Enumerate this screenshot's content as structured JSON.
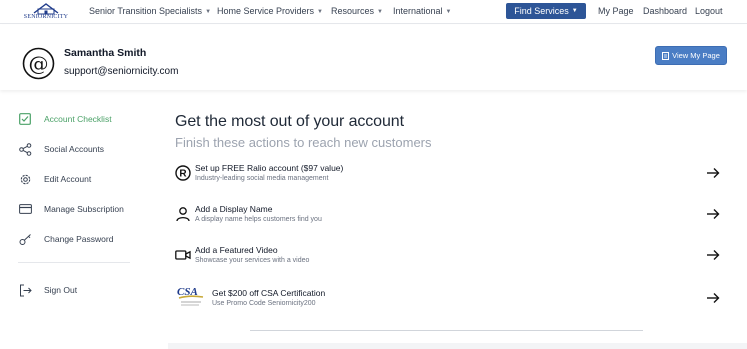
{
  "nav": {
    "logo_text": "SENIORNICITY",
    "items": [
      {
        "label": "Senior Transition Specialists"
      },
      {
        "label": "Home Service Providers"
      },
      {
        "label": "Resources"
      },
      {
        "label": "International"
      }
    ],
    "find_services": "Find Services",
    "my_page": "My Page",
    "dashboard": "Dashboard",
    "logout": "Logout"
  },
  "profile": {
    "avatar_icon": "at-sign-icon",
    "name": "Samantha Smith",
    "email": "support@seniornicity.com",
    "view_button": "View My Page"
  },
  "sidebar": {
    "items": [
      {
        "label": "Account Checklist",
        "icon": "checkbox-icon",
        "active": true
      },
      {
        "label": "Social Accounts",
        "icon": "share-icon"
      },
      {
        "label": "Edit Account",
        "icon": "gear-icon"
      },
      {
        "label": "Manage Subscription",
        "icon": "credit-card-icon"
      },
      {
        "label": "Change Password",
        "icon": "key-icon"
      }
    ],
    "sign_out": "Sign Out"
  },
  "main": {
    "title": "Get the most out of your account",
    "subtitle": "Finish these actions to reach new customers",
    "actions": [
      {
        "title": "Set up FREE Ralio account ($97 value)",
        "desc": "Industry-leading social media management",
        "icon": "ralio-icon"
      },
      {
        "title": "Add a Display Name",
        "desc": "A display name helps customers find you",
        "icon": "user-icon"
      },
      {
        "title": "Add a Featured Video",
        "desc": "Showcase your services with a video",
        "icon": "video-icon"
      },
      {
        "title": "Get $200 off CSA Certification",
        "desc": "Use Promo Code Seniornicity200",
        "icon": "csa-logo",
        "logo_text": "CSA"
      }
    ]
  },
  "colors": {
    "primary": "#2d5597",
    "button": "#4a7dc4",
    "active": "#4aa167"
  }
}
